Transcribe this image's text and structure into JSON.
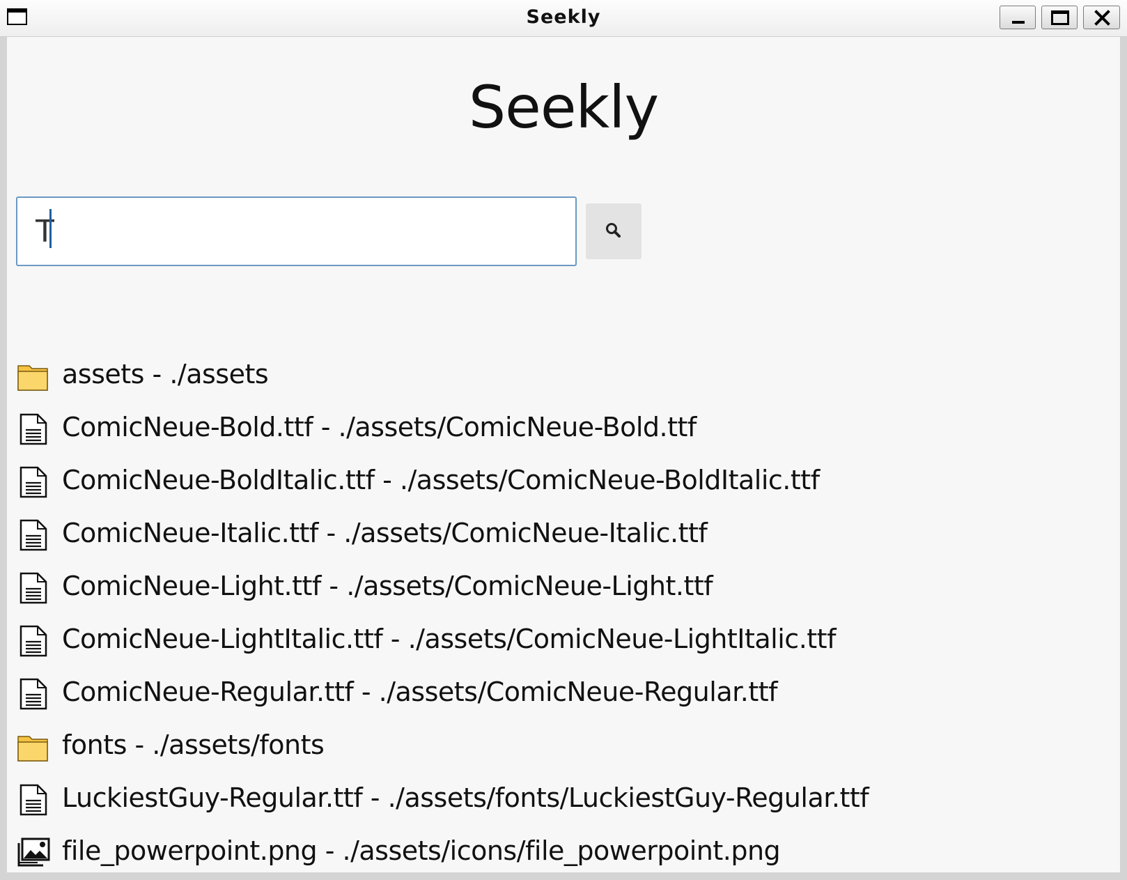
{
  "window": {
    "title": "Seekly",
    "controls": [
      "minimize-icon",
      "maximize-icon",
      "close-icon"
    ]
  },
  "app": {
    "title": "Seekly"
  },
  "search": {
    "value": "T",
    "placeholder": "",
    "button_icon": "search-icon"
  },
  "colors": {
    "input_border": "#6b98c2",
    "background": "#f7f7f7",
    "folder": "#f7c948"
  },
  "results": [
    {
      "type": "folder",
      "icon": "folder-icon",
      "text": "assets - ./assets"
    },
    {
      "type": "file",
      "icon": "file-icon",
      "text": "ComicNeue-Bold.ttf - ./assets/ComicNeue-Bold.ttf"
    },
    {
      "type": "file",
      "icon": "file-icon",
      "text": "ComicNeue-BoldItalic.ttf - ./assets/ComicNeue-BoldItalic.ttf"
    },
    {
      "type": "file",
      "icon": "file-icon",
      "text": "ComicNeue-Italic.ttf - ./assets/ComicNeue-Italic.ttf"
    },
    {
      "type": "file",
      "icon": "file-icon",
      "text": "ComicNeue-Light.ttf - ./assets/ComicNeue-Light.ttf"
    },
    {
      "type": "file",
      "icon": "file-icon",
      "text": "ComicNeue-LightItalic.ttf - ./assets/ComicNeue-LightItalic.ttf"
    },
    {
      "type": "file",
      "icon": "file-icon",
      "text": "ComicNeue-Regular.ttf - ./assets/ComicNeue-Regular.ttf"
    },
    {
      "type": "folder",
      "icon": "folder-icon",
      "text": "fonts - ./assets/fonts"
    },
    {
      "type": "file",
      "icon": "file-icon",
      "text": "LuckiestGuy-Regular.ttf - ./assets/fonts/LuckiestGuy-Regular.ttf"
    },
    {
      "type": "image",
      "icon": "image-icon",
      "text": "file_powerpoint.png - ./assets/icons/file_powerpoint.png"
    }
  ]
}
